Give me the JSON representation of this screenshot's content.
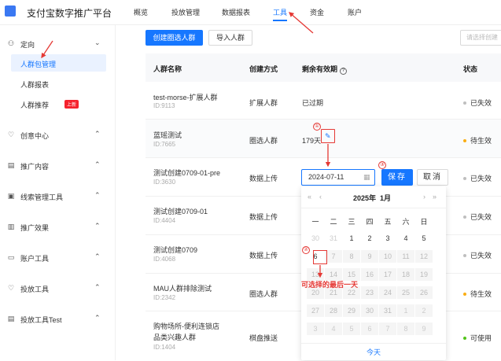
{
  "app": {
    "brand": "支付宝数字推广平台"
  },
  "nav": {
    "tabs": [
      {
        "label": "概览"
      },
      {
        "label": "投放管理"
      },
      {
        "label": "数据报表"
      },
      {
        "label": "工具"
      },
      {
        "label": "资金"
      },
      {
        "label": "账户"
      }
    ],
    "active": "工具"
  },
  "sidebar": {
    "groups": [
      {
        "label": "定向",
        "icon": "target-icon",
        "expanded": true
      },
      {
        "label": "创意中心",
        "icon": "bulb-icon"
      },
      {
        "label": "推广内容",
        "icon": "doc-icon"
      },
      {
        "label": "线索管理工具",
        "icon": "clue-icon"
      },
      {
        "label": "推广效果",
        "icon": "chart-icon"
      },
      {
        "label": "账户工具",
        "icon": "card-icon"
      },
      {
        "label": "投放工具",
        "icon": "bulb-icon"
      },
      {
        "label": "投放工具Test",
        "icon": "doc-icon"
      }
    ],
    "sub": [
      {
        "label": "人群包管理",
        "active": true
      },
      {
        "label": "人群报表"
      },
      {
        "label": "人群推荐",
        "badge": "上新"
      }
    ]
  },
  "toolbar": {
    "create": "创建圈选人群",
    "import": "导入人群",
    "select_placeholder": "请选择创建"
  },
  "table": {
    "headers": {
      "name": "人群名称",
      "method": "创建方式",
      "validity": "剩余有效期",
      "status": "状态"
    },
    "rows": [
      {
        "name": "test-morse-扩展人群",
        "id": "ID:9113",
        "method": "扩展人群",
        "validity": "已过期",
        "status": "已失效",
        "status_color": "#bfbfbf"
      },
      {
        "name": "蓝瑶测试",
        "id": "ID:7665",
        "method": "圈选人群",
        "validity": "179天",
        "status": "待生效",
        "status_color": "#faad14"
      },
      {
        "name": "测试创建0709-01-pre",
        "id": "ID:3630",
        "method": "数据上传",
        "validity": "",
        "status": "已失效",
        "status_color": "#bfbfbf"
      },
      {
        "name": "测试创建0709-01",
        "id": "ID:4404",
        "method": "数据上传",
        "validity": "",
        "status": "已失效",
        "status_color": "#bfbfbf"
      },
      {
        "name": "测试创建0709",
        "id": "ID:4068",
        "method": "数据上传",
        "validity": "",
        "status": "已失效",
        "status_color": "#bfbfbf"
      },
      {
        "name": "MAU人群排除测试",
        "id": "ID:2342",
        "method": "圈选人群",
        "validity": "",
        "status": "待生效",
        "status_color": "#faad14"
      },
      {
        "name": "购物场所-便利连锁店",
        "name2": "品类兴趣人群",
        "id": "ID:1404",
        "method": "棋盘推送",
        "validity": "",
        "status": "可使用",
        "status_color": "#52c41a"
      }
    ]
  },
  "editor": {
    "date_value": "2024-07-11",
    "save": "保存",
    "cancel": "取消"
  },
  "calendar": {
    "title_year": "2025年",
    "title_month": "1月",
    "weekdays": [
      "一",
      "二",
      "三",
      "四",
      "五",
      "六",
      "日"
    ],
    "weeks": [
      [
        "30",
        "31",
        "1",
        "2",
        "3",
        "4",
        "5"
      ],
      [
        "6",
        "7",
        "8",
        "9",
        "10",
        "11",
        "12"
      ],
      [
        "13",
        "14",
        "15",
        "16",
        "17",
        "18",
        "19"
      ],
      [
        "20",
        "21",
        "22",
        "23",
        "24",
        "25",
        "26"
      ],
      [
        "27",
        "28",
        "29",
        "30",
        "31",
        "1",
        "2"
      ],
      [
        "3",
        "4",
        "5",
        "6",
        "7",
        "8",
        "9"
      ]
    ],
    "today": "今天"
  },
  "annotations": {
    "n1": "①",
    "n2": "②",
    "n3": "③",
    "note": "可选择的最后一天"
  }
}
